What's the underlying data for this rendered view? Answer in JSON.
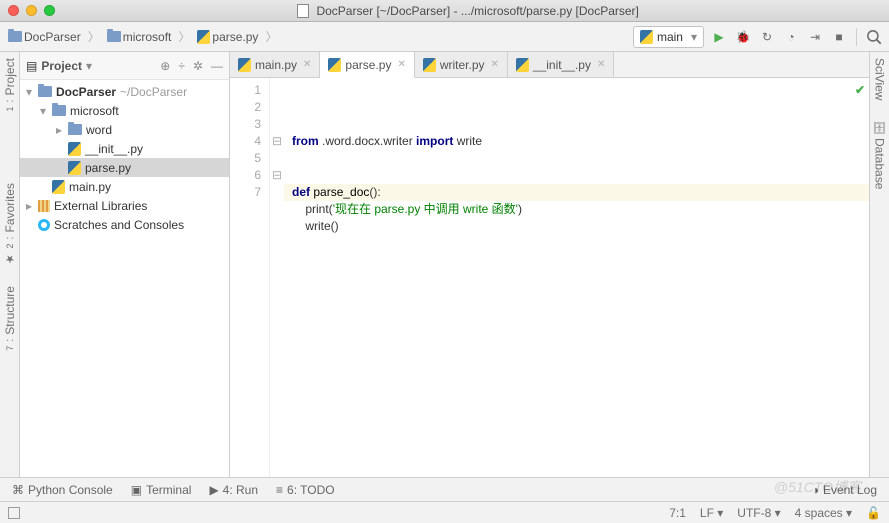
{
  "window": {
    "title": "DocParser [~/DocParser] - .../microsoft/parse.py [DocParser]"
  },
  "breadcrumbs": [
    {
      "label": "DocParser",
      "type": "folder"
    },
    {
      "label": "microsoft",
      "type": "folder"
    },
    {
      "label": "parse.py",
      "type": "py"
    }
  ],
  "run_config": {
    "label": "main"
  },
  "rails": {
    "left": [
      {
        "num": "1",
        "label": "Project"
      },
      {
        "num": "2",
        "label": "Favorites"
      },
      {
        "num": "7",
        "label": "Structure"
      }
    ],
    "right": [
      {
        "label": "SciView"
      },
      {
        "label": "Database"
      }
    ]
  },
  "project_panel": {
    "title": "Project",
    "tree": [
      {
        "label": "DocParser",
        "hint": "~/DocParser",
        "indent": 0,
        "icon": "folder",
        "tw": "▾",
        "bold": true
      },
      {
        "label": "microsoft",
        "indent": 1,
        "icon": "folder",
        "tw": "▾"
      },
      {
        "label": "word",
        "indent": 2,
        "icon": "folder",
        "tw": "▸"
      },
      {
        "label": "__init__.py",
        "indent": 2,
        "icon": "py",
        "tw": ""
      },
      {
        "label": "parse.py",
        "indent": 2,
        "icon": "py",
        "tw": "",
        "selected": true
      },
      {
        "label": "main.py",
        "indent": 1,
        "icon": "py",
        "tw": ""
      },
      {
        "label": "External Libraries",
        "indent": 0,
        "icon": "lib",
        "tw": "▸"
      },
      {
        "label": "Scratches and Consoles",
        "indent": 0,
        "icon": "scratch",
        "tw": ""
      }
    ]
  },
  "tabs": [
    {
      "label": "main.py",
      "active": false
    },
    {
      "label": "parse.py",
      "active": true
    },
    {
      "label": "writer.py",
      "active": false
    },
    {
      "label": "__init__.py",
      "active": false
    }
  ],
  "code": {
    "lines": [
      {
        "n": 1,
        "html": "<span class='kw'>from</span> .word.docx.writer <span class='kw'>import</span> write"
      },
      {
        "n": 2,
        "html": ""
      },
      {
        "n": 3,
        "html": ""
      },
      {
        "n": 4,
        "html": "<span class='kw'>def</span> <span class='fn'>parse_doc</span>():",
        "fold": "⊟"
      },
      {
        "n": 5,
        "html": "    print(<span class='str'>'现在在 parse.py 中调用 write 函数'</span>)"
      },
      {
        "n": 6,
        "html": "    write()",
        "fold": "⊟"
      },
      {
        "n": 7,
        "html": "",
        "current": true
      }
    ]
  },
  "toolwindows": [
    {
      "label": "Python Console",
      "icon": "⌘"
    },
    {
      "label": "Terminal",
      "icon": "▣"
    },
    {
      "label": "4: Run",
      "icon": "▶"
    },
    {
      "label": "6: TODO",
      "icon": "≡"
    }
  ],
  "event_log": "Event Log",
  "status": {
    "position": "7:1",
    "line_sep": "LF",
    "encoding": "UTF-8",
    "indent": "4 spaces"
  },
  "watermark": "@51CTO博客"
}
